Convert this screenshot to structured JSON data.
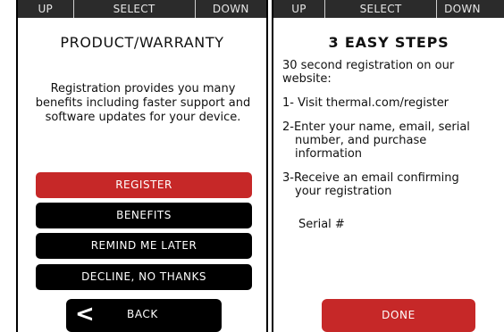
{
  "left": {
    "nav": {
      "up": "UP",
      "select": "SELECT",
      "down": "DOWN"
    },
    "title": "PRODUCT/WARRANTY",
    "description": "Registration provides you many benefits including faster support and software updates for your device.",
    "buttons": {
      "register": "REGISTER",
      "benefits": "BENEFITS",
      "remind": "REMIND ME LATER",
      "decline": "DECLINE, NO THANKS",
      "back": "BACK"
    }
  },
  "right": {
    "nav": {
      "up": "UP",
      "select": "SELECT",
      "down": "DOWN"
    },
    "title": "3 EASY STEPS",
    "intro": "30 second registration on our website:",
    "step1": "1- Visit thermal.com/register",
    "step2_line1": "2-Enter your name, email, serial",
    "step2_line2": "number, and purchase",
    "step2_line3": "information",
    "step3_line1": "3-Receive an email confirming",
    "step3_line2": "your registration",
    "serial_label": "Serial #",
    "done": "DONE"
  },
  "colors": {
    "accent_red": "#c62828",
    "nav_bg": "#2b2b2b",
    "button_bg": "#000000"
  }
}
